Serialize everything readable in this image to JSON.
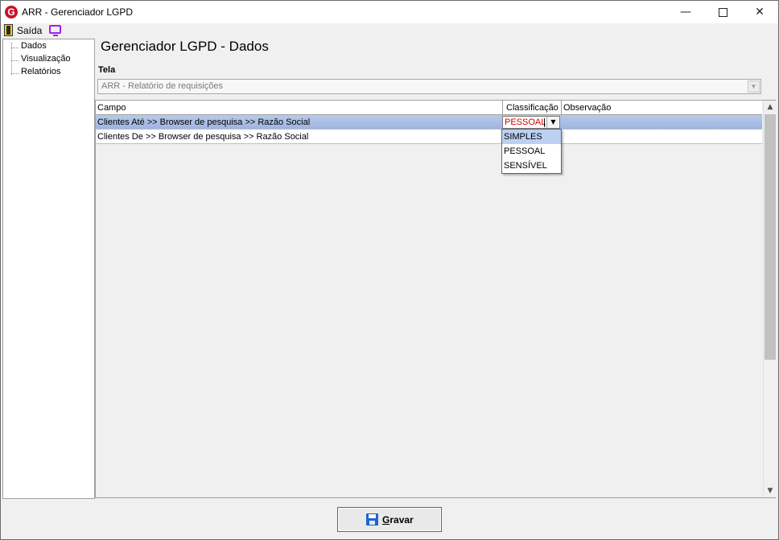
{
  "window": {
    "title": "ARR - Gerenciador LGPD",
    "logo_letter": "G",
    "minimize": "—",
    "close": "✕"
  },
  "menubar": {
    "exit_label": "Saída"
  },
  "tree": {
    "items": [
      "Dados",
      "Visualização",
      "Relatórios"
    ]
  },
  "main": {
    "heading": "Gerenciador LGPD - Dados",
    "tela_label": "Tela",
    "tela_value": "ARR - Relatório de requisições"
  },
  "grid": {
    "columns": [
      "Campo",
      "Classificação",
      "Observação"
    ],
    "rows": [
      {
        "campo": "Clientes Até >> Browser de pesquisa >> Razão Social",
        "classificacao": "PESSOAL",
        "observacao": ""
      },
      {
        "campo": "Clientes De >> Browser de pesquisa >> Razão Social",
        "classificacao": "",
        "observacao": ""
      }
    ],
    "classification_options": [
      "SIMPLES",
      "PESSOAL",
      "SENSÍVEL"
    ],
    "highlighted_option": "SIMPLES"
  },
  "footer": {
    "save_first_letter": "G",
    "save_rest": "ravar"
  },
  "colors": {
    "selected_row": "#b9c9ea",
    "edit_value": "#d00000",
    "monitor_icon": "#a020f0",
    "logo": "#c8102e"
  }
}
